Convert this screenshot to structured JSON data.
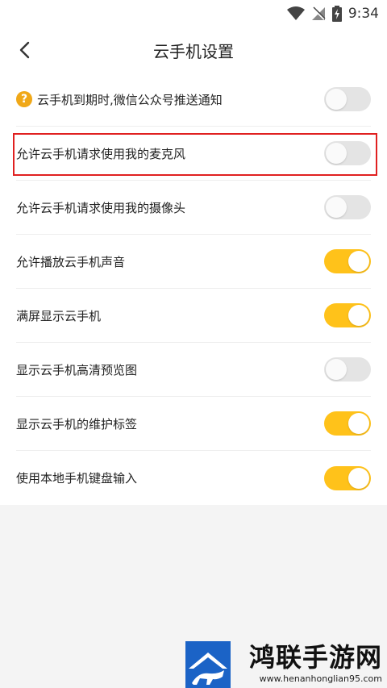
{
  "status_bar": {
    "time": "9:34",
    "icons": [
      "wifi-icon",
      "no-signal-icon",
      "battery-charging-icon"
    ]
  },
  "header": {
    "back_icon": "chevron-left-icon",
    "title": "云手机设置"
  },
  "settings": [
    {
      "label": "云手机到期时,微信公众号推送通知",
      "on": false,
      "help": true
    },
    {
      "label": "允许云手机请求使用我的麦克风",
      "on": false,
      "highlighted": true
    },
    {
      "label": "允许云手机请求使用我的摄像头",
      "on": false
    },
    {
      "label": "允许播放云手机声音",
      "on": true
    },
    {
      "label": "满屏显示云手机",
      "on": true
    },
    {
      "label": "显示云手机高清预览图",
      "on": false
    },
    {
      "label": "显示云手机的维护标签",
      "on": true
    },
    {
      "label": "使用本地手机键盘输入",
      "on": true
    }
  ],
  "colors": {
    "toggle_on": "#ffc21a",
    "toggle_off": "#e4e4e4",
    "highlight": "#e02020",
    "help_icon": "#f0a818"
  },
  "watermark": {
    "name": "鸿联手游网",
    "url": "www.henanhonglian95.com"
  }
}
